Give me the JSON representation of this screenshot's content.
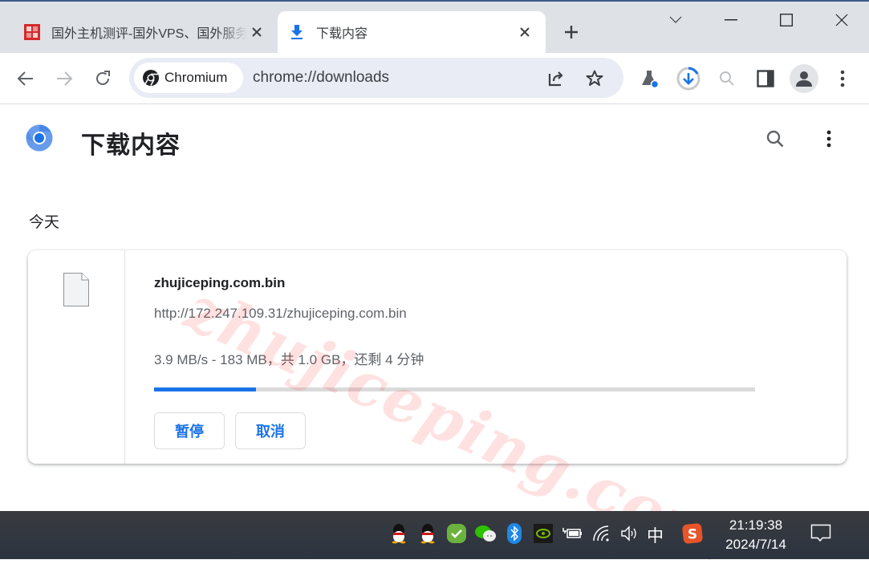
{
  "browser": {
    "tabs": [
      {
        "title": "国外主机测评-国外VPS、国外服务器",
        "favicon": "site-seal-icon",
        "active": false
      },
      {
        "title": "下载内容",
        "favicon": "download-icon",
        "active": true
      }
    ],
    "window_controls": [
      "tab-search-chevron",
      "minimize",
      "maximize",
      "close"
    ],
    "omnibox": {
      "chip_label": "Chromium",
      "url": "chrome://downloads"
    },
    "toolbar_icons": [
      "back-icon",
      "forward-icon",
      "reload-icon",
      "share-icon",
      "bookmark-star-icon",
      "labs-flask-icon",
      "download-progress-icon",
      "zoom-icon",
      "side-panel-icon",
      "profile-avatar-icon",
      "menu-kebab-icon"
    ]
  },
  "page": {
    "title": "下载内容",
    "section_label": "今天",
    "download": {
      "file_name": "zhujiceping.com.bin",
      "url": "http://172.247.109.31/zhujiceping.com.bin",
      "status": "3.9 MB/s - 183 MB，共 1.0 GB，还剩 4 分钟",
      "progress_percent": 17,
      "pause_label": "暂停",
      "cancel_label": "取消"
    },
    "watermark": "zhujiceping.com"
  },
  "taskbar": {
    "tray_icons": [
      "qq-icon",
      "qq-icon",
      "security-check-icon",
      "wechat-icon",
      "bluetooth-icon",
      "nvidia-icon",
      "battery-charging-icon",
      "wifi-icon",
      "volume-icon"
    ],
    "ime": "中",
    "time": "21:19:38",
    "date": "2024/7/14"
  },
  "colors": {
    "accent": "#1a73e8",
    "tab_strip": "#dee1e6",
    "omnibox": "#e9ecf5",
    "taskbar": "#2f353d"
  }
}
